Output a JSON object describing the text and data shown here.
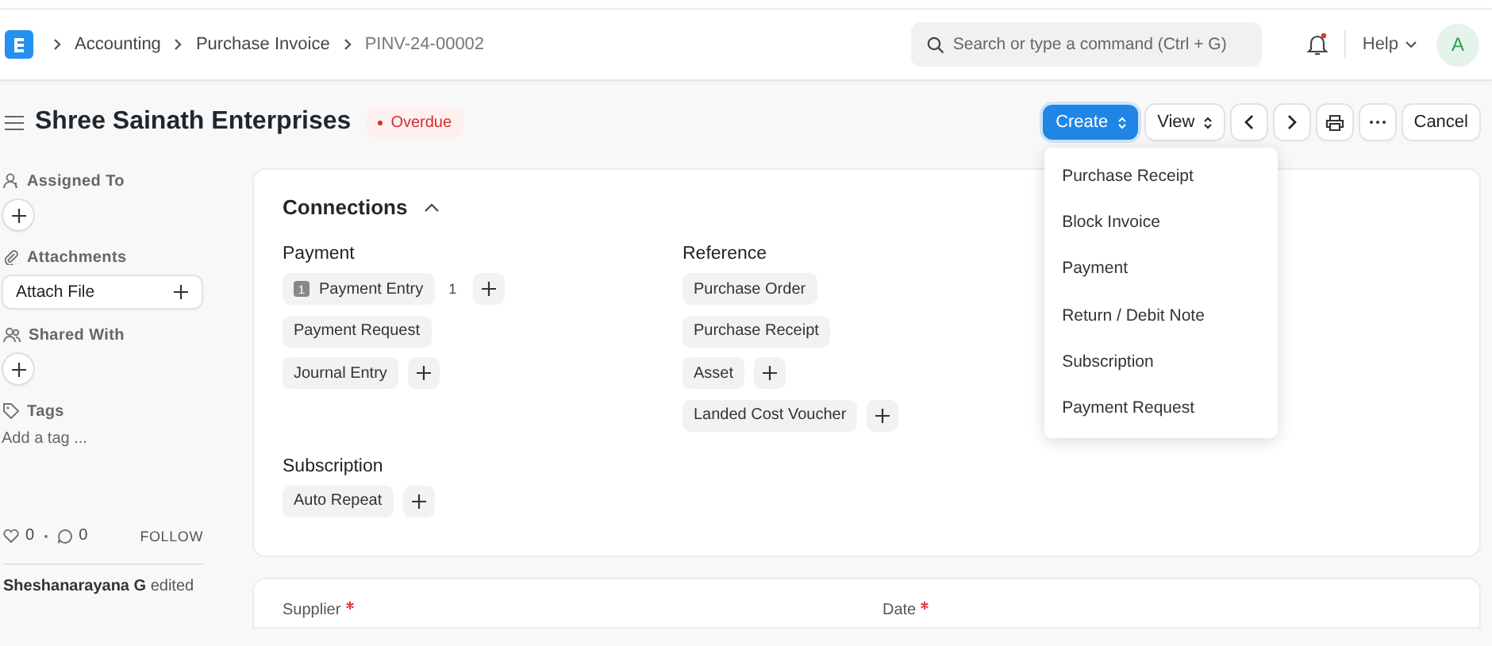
{
  "breadcrumbs": [
    "Accounting",
    "Purchase Invoice",
    "PINV-24-00002"
  ],
  "search": {
    "placeholder": "Search or type a command (Ctrl + G)"
  },
  "notifications": {
    "unread": true
  },
  "help": "Help",
  "avatar": "A",
  "page": {
    "title": "Shree Sainath Enterprises",
    "status": "Overdue"
  },
  "actions": [
    {
      "kind": "primary",
      "label": "Create",
      "expanded": true
    },
    {
      "kind": "dropdown",
      "label": "View"
    },
    {
      "kind": "prev"
    },
    {
      "kind": "next"
    },
    {
      "kind": "print"
    },
    {
      "kind": "more"
    },
    {
      "kind": "plain",
      "label": "Cancel"
    }
  ],
  "create_menu": [
    "Purchase Receipt",
    "Block Invoice",
    "Payment",
    "Return / Debit Note",
    "Subscription",
    "Payment Request"
  ],
  "sidebar": {
    "sections": [
      {
        "kind": "assign",
        "title": "Assigned To"
      },
      {
        "kind": "attach",
        "title": "Attachments",
        "button": "Attach File"
      },
      {
        "kind": "share",
        "title": "Shared With"
      },
      {
        "kind": "tags",
        "title": "Tags",
        "placeholder": "Add a tag ..."
      }
    ],
    "likes": "0",
    "comments": "0",
    "follow": "FOLLOW",
    "activity": "**Sheshanarayana G** edited"
  },
  "connections": {
    "title": "Connections",
    "expanded": true,
    "groups": [
      {
        "title": "Payment",
        "items": [
          {
            "label": "Payment Entry",
            "badge": "1",
            "count": "1",
            "can_add": true
          },
          {
            "label": "Payment Request",
            "can_add": false
          },
          {
            "label": "Journal Entry",
            "can_add": true
          }
        ]
      },
      {
        "title": "Reference",
        "items": [
          {
            "label": "Purchase Order",
            "can_add": false
          },
          {
            "label": "Purchase Receipt",
            "can_add": false
          },
          {
            "label": "Asset",
            "can_add": true
          },
          {
            "label": "Landed Cost Voucher",
            "can_add": true
          }
        ]
      },
      {
        "title": "Subscription",
        "items": [
          {
            "label": "Auto Repeat",
            "can_add": true
          }
        ]
      }
    ]
  },
  "fields": [
    {
      "label": "Supplier",
      "required": true
    },
    {
      "label": "Date",
      "required": true
    }
  ]
}
